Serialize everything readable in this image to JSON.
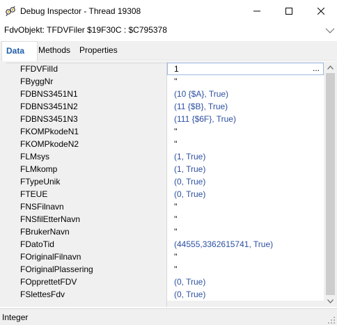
{
  "window": {
    "title": "Debug Inspector - Thread 19308",
    "app_icon": "debug-inspector-icon"
  },
  "object": {
    "label": "FdvObjekt: TFDVFiler $19F30C : $C795378"
  },
  "tabs": [
    {
      "label": "Data",
      "active": true
    },
    {
      "label": "Methods",
      "active": false
    },
    {
      "label": "Properties",
      "active": false
    }
  ],
  "rows": [
    {
      "name": "FFDVFilId",
      "value": "1",
      "editing": true,
      "ellipsis": "..."
    },
    {
      "name": "FByggNr",
      "value": "''"
    },
    {
      "name": "FDBNS3451N1",
      "value": "(10 {$A}, True)"
    },
    {
      "name": "FDBNS3451N2",
      "value": "(11 {$B}, True)"
    },
    {
      "name": "FDBNS3451N3",
      "value": "(111 {$6F}, True)"
    },
    {
      "name": "FKOMPkodeN1",
      "value": "''"
    },
    {
      "name": "FKOMPkodeN2",
      "value": "''"
    },
    {
      "name": "FLMsys",
      "value": "(1, True)"
    },
    {
      "name": "FLMkomp",
      "value": "(1, True)"
    },
    {
      "name": "FTypeUnik",
      "value": "(0, True)"
    },
    {
      "name": "FTEUE",
      "value": "(0, True)"
    },
    {
      "name": "FNSFilnavn",
      "value": "''"
    },
    {
      "name": "FNSfilEtterNavn",
      "value": "''"
    },
    {
      "name": "FBrukerNavn",
      "value": "''"
    },
    {
      "name": "FDatoTid",
      "value": "(44555,3362615741, True)"
    },
    {
      "name": "FOriginalFilnavn",
      "value": "''"
    },
    {
      "name": "FOriginalPlassering",
      "value": "''"
    },
    {
      "name": "FOpprettetFDV",
      "value": "(0, True)"
    },
    {
      "name": "FSlettesFdv",
      "value": "(0, True)"
    }
  ],
  "status": {
    "text": "Integer"
  },
  "colors": {
    "value_text": "#2b4fa0",
    "active_tab_text": "#1f5ea8",
    "panel_bg": "#f0f0f0"
  }
}
